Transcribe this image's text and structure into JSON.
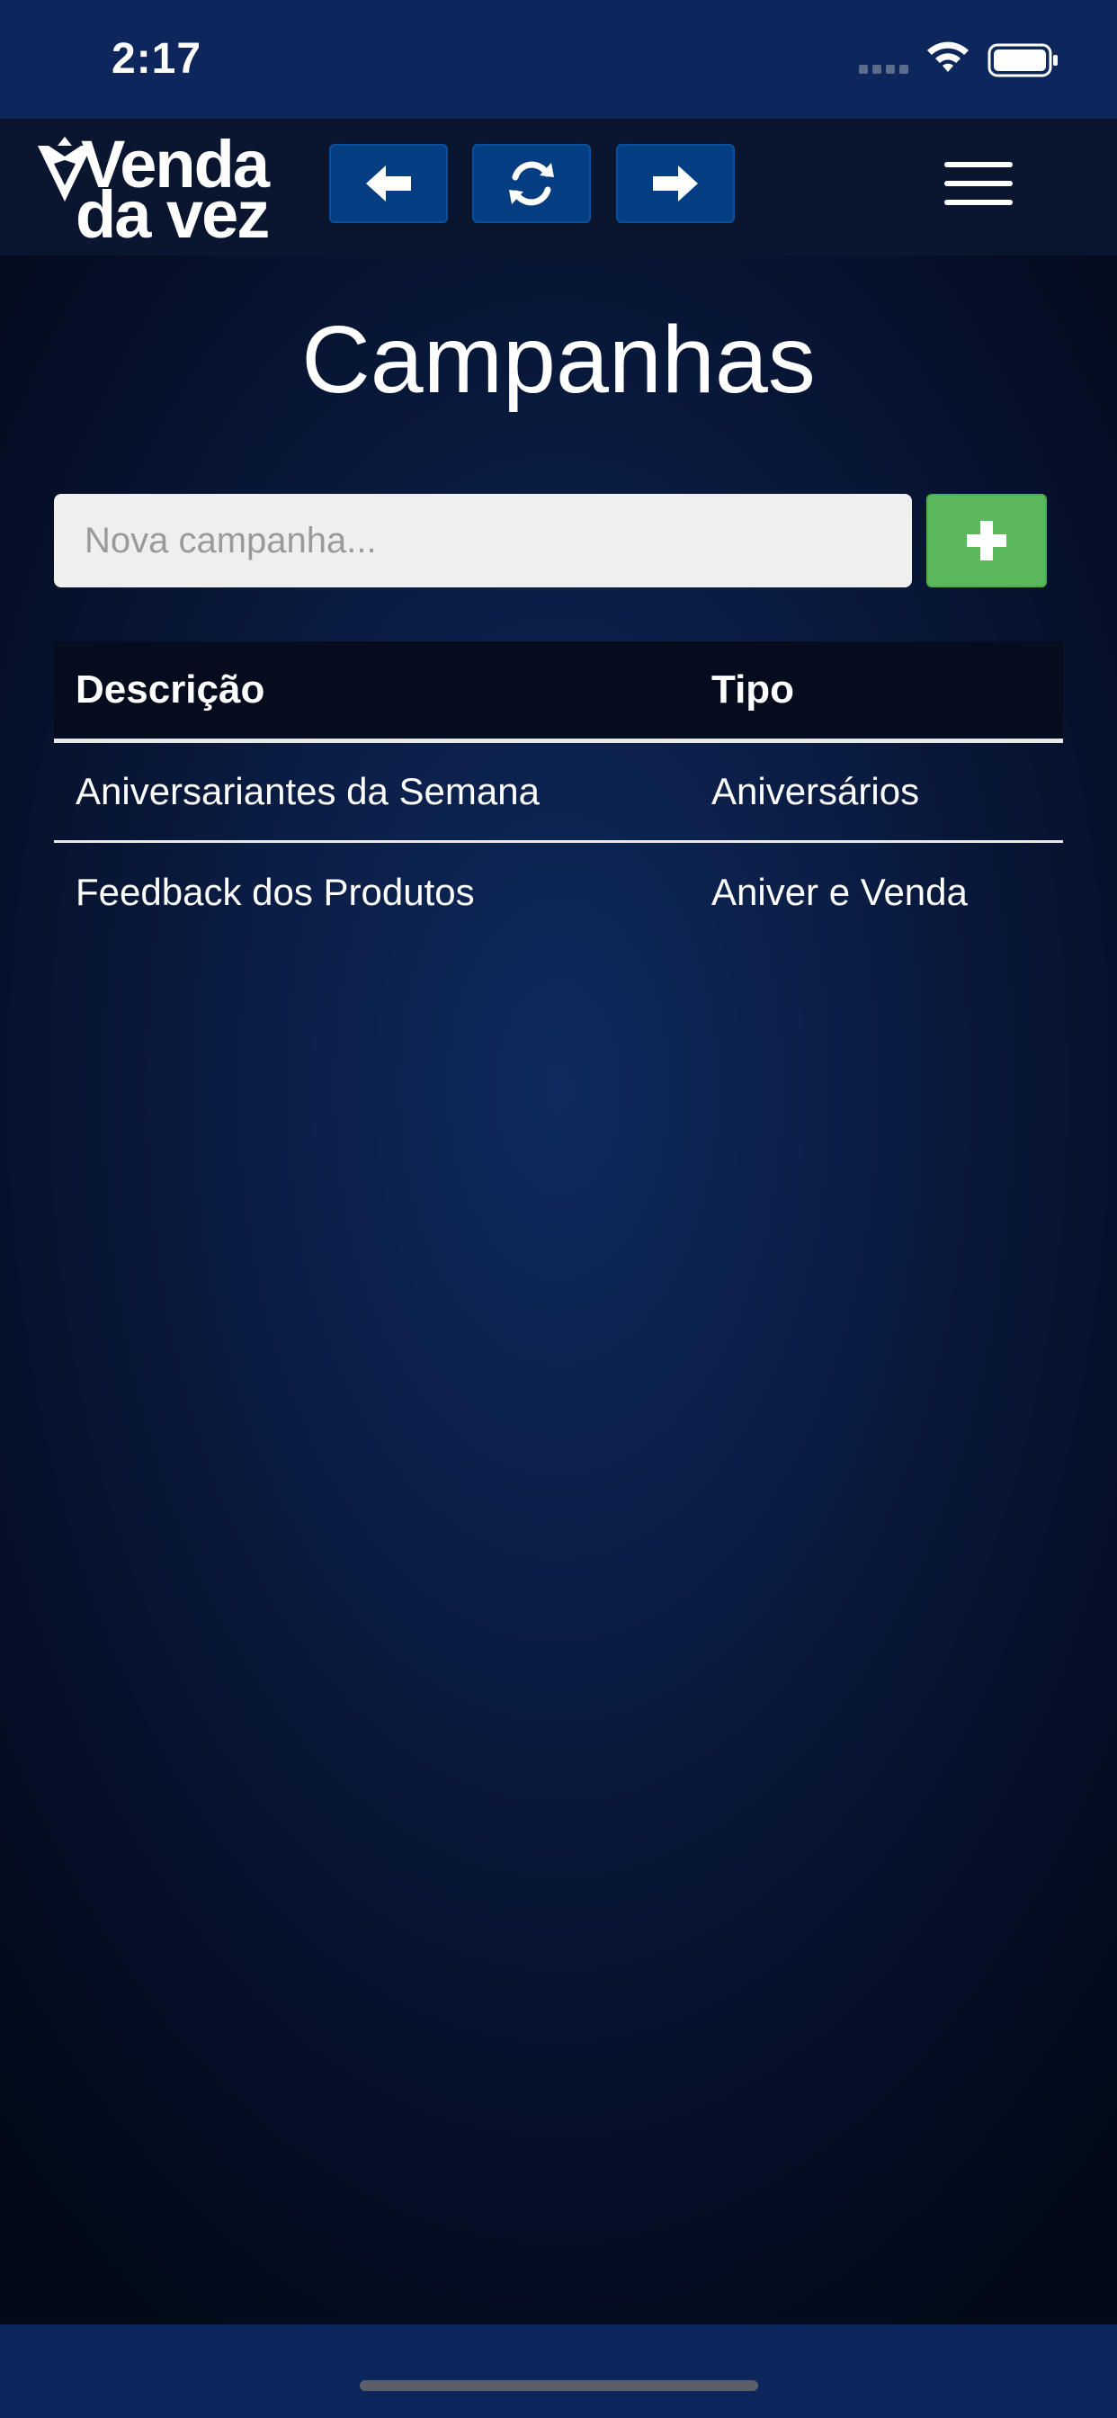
{
  "status_bar": {
    "time": "2:17"
  },
  "navbar": {
    "logo_line1": "Venda",
    "logo_line2": "da vez",
    "back_icon": "arrow-left-icon",
    "refresh_icon": "refresh-icon",
    "forward_icon": "arrow-right-icon",
    "menu_icon": "hamburger-menu-icon"
  },
  "page": {
    "title": "Campanhas"
  },
  "new_campaign": {
    "placeholder": "Nova campanha...",
    "value": "",
    "add_icon": "plus-icon"
  },
  "table": {
    "headers": {
      "description": "Descrição",
      "type": "Tipo"
    },
    "rows": [
      {
        "description": "Aniversariantes da Semana",
        "type": "Aniversários"
      },
      {
        "description": "Feedback dos Produtos",
        "type": "Aniver e Venda"
      }
    ]
  },
  "colors": {
    "status_bar_bg": "#0d275c",
    "navbar_bg": "#0a1630",
    "nav_button_bg": "#043d82",
    "add_button_bg": "#5cb85c",
    "table_header_bg": "#040c1d"
  }
}
